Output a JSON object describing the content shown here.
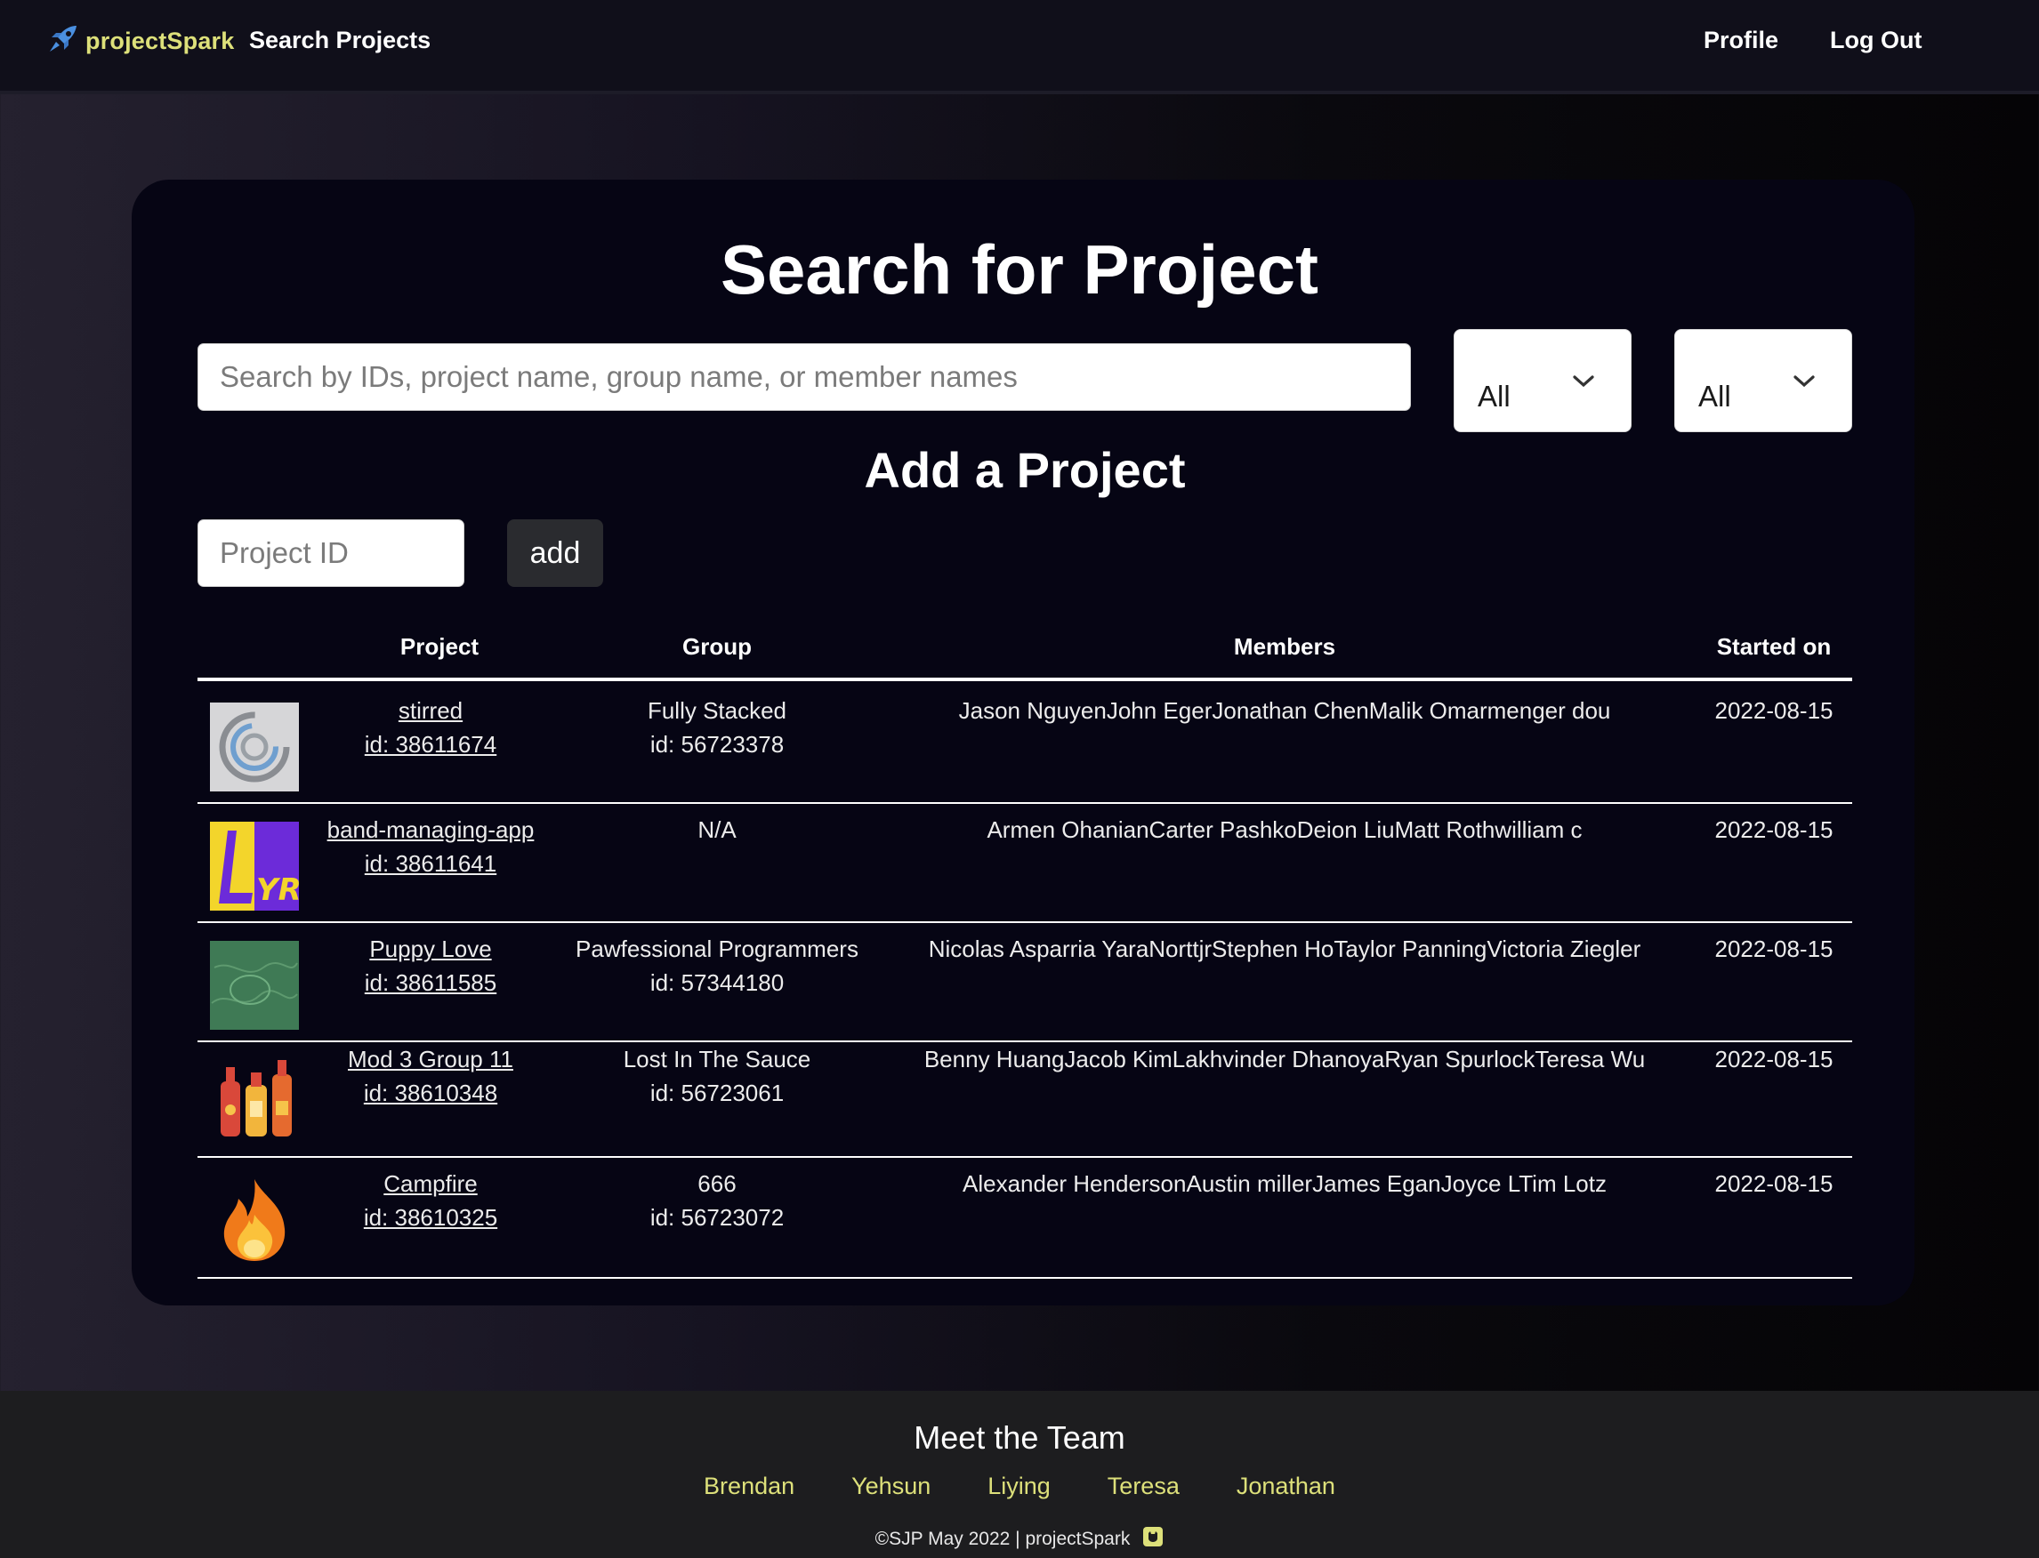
{
  "nav": {
    "brand": "projectSpark",
    "search_projects": "Search Projects",
    "profile": "Profile",
    "logout": "Log Out"
  },
  "search": {
    "title": "Search for Project",
    "placeholder": "Search by IDs, project name, group name, or member names",
    "filter1": "All",
    "filter2": "All"
  },
  "add": {
    "title": "Add a Project",
    "placeholder": "Project ID",
    "button": "add"
  },
  "table": {
    "headers": {
      "project": "Project",
      "group": "Group",
      "members": "Members",
      "started": "Started on"
    },
    "rows": [
      {
        "icon": "stirred-logo-icon",
        "project": "stirred",
        "project_id": "id: 38611674",
        "group": "Fully Stacked",
        "group_id": "id: 56723378",
        "members": "Jason NguyenJohn EgerJonathan ChenMalik Omarmenger dou",
        "started": "2022-08-15"
      },
      {
        "icon": "lyra-logo-icon",
        "project": "band-managing-app",
        "project_id": "id: 38611641",
        "group": "N/A",
        "group_id": "",
        "members": "Armen OhanianCarter PashkoDeion LiuMatt Rothwilliam c",
        "started": "2022-08-15"
      },
      {
        "icon": "puppy-map-icon",
        "project": "Puppy Love",
        "project_id": "id: 38611585",
        "group": "Pawfessional Programmers",
        "group_id": "id: 57344180",
        "members": "Nicolas Asparria YaraNorttjrStephen HoTaylor PanningVictoria Ziegler",
        "started": "2022-08-15"
      },
      {
        "icon": "sauce-bottles-icon",
        "project": "Mod 3 Group 11",
        "project_id": "id: 38610348",
        "group": "Lost In The Sauce",
        "group_id": "id: 56723061",
        "members": "Benny HuangJacob KimLakhvinder DhanoyaRyan SpurlockTeresa Wu",
        "started": "2022-08-15"
      },
      {
        "icon": "fire-icon",
        "project": "Campfire",
        "project_id": "id: 38610325",
        "group": "666",
        "group_id": "id: 56723072",
        "members": "Alexander HendersonAustin millerJames EganJoyce LTim Lotz",
        "started": "2022-08-15"
      }
    ]
  },
  "footer": {
    "title": "Meet the Team",
    "team": [
      "Brendan",
      "Yehsun",
      "Liying",
      "Teresa",
      "Jonathan"
    ],
    "copyright": "©SJP May 2022 | projectSpark"
  },
  "colors": {
    "accent": "#dde07a",
    "card": "#060514",
    "navbar": "#100f1a",
    "footer": "#1d1d1f"
  }
}
